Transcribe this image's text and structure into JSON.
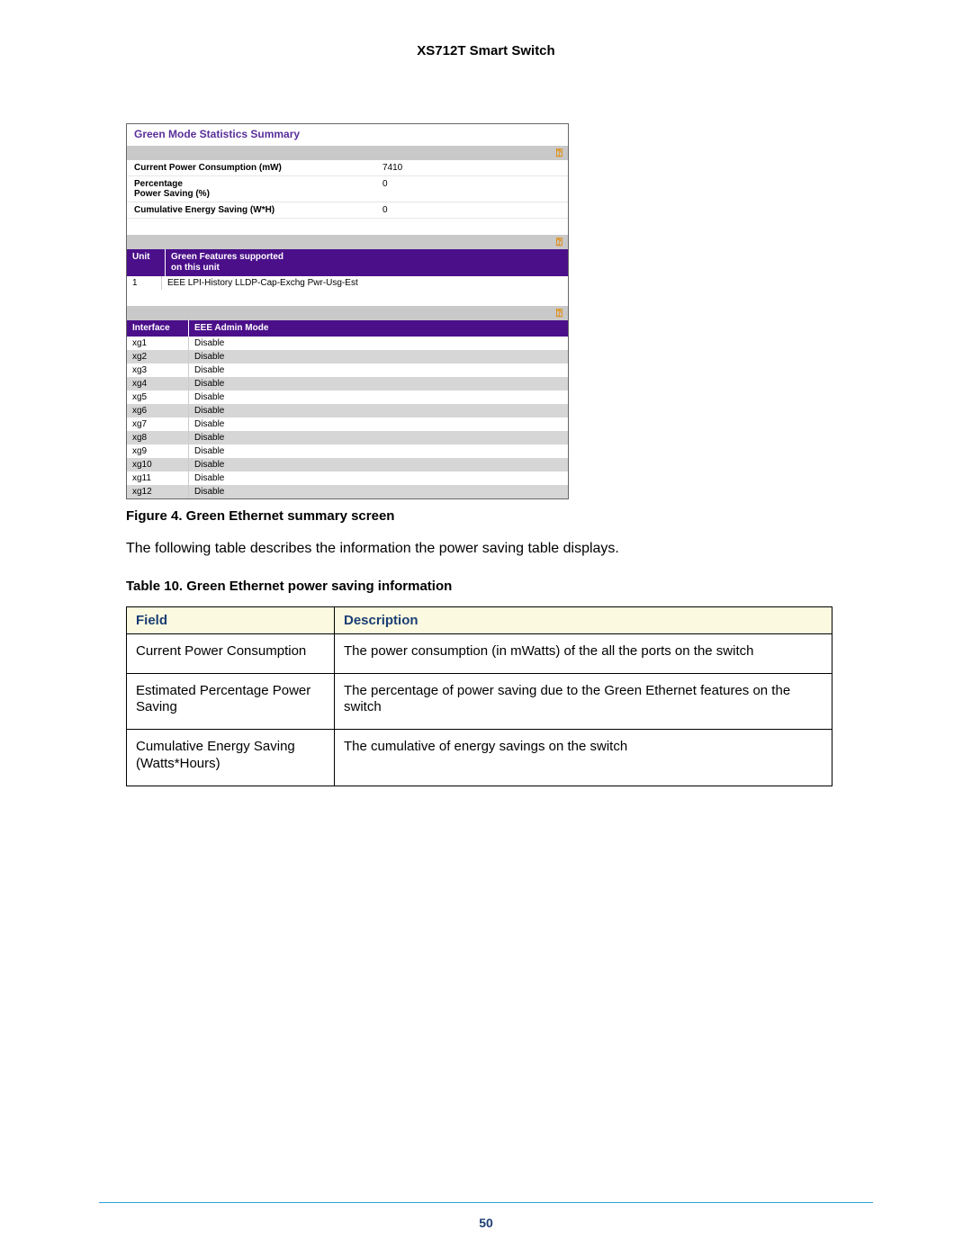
{
  "doc_header": "XS712T Smart Switch",
  "screenshot": {
    "title": "Green Mode Statistics Summary",
    "stats": [
      {
        "label": "Current Power Consumption (mW)",
        "value": "7410"
      },
      {
        "label": "Percentage\nPower Saving (%)",
        "value": "0"
      },
      {
        "label": "Cumulative Energy Saving (W*H)",
        "value": "0"
      }
    ],
    "unit_header": {
      "col1": "Unit",
      "col2": "Green Features supported\non this unit"
    },
    "unit_rows": [
      {
        "unit": "1",
        "features": "EEE LPI-History LLDP-Cap-Exchg Pwr-Usg-Est"
      }
    ],
    "iface_header": {
      "col1": "Interface",
      "col2": "EEE Admin Mode"
    },
    "iface_rows": [
      {
        "iface": "xg1",
        "mode": "Disable"
      },
      {
        "iface": "xg2",
        "mode": "Disable"
      },
      {
        "iface": "xg3",
        "mode": "Disable"
      },
      {
        "iface": "xg4",
        "mode": "Disable"
      },
      {
        "iface": "xg5",
        "mode": "Disable"
      },
      {
        "iface": "xg6",
        "mode": "Disable"
      },
      {
        "iface": "xg7",
        "mode": "Disable"
      },
      {
        "iface": "xg8",
        "mode": "Disable"
      },
      {
        "iface": "xg9",
        "mode": "Disable"
      },
      {
        "iface": "xg10",
        "mode": "Disable"
      },
      {
        "iface": "xg11",
        "mode": "Disable"
      },
      {
        "iface": "xg12",
        "mode": "Disable"
      }
    ]
  },
  "fig_caption": "Figure 4. Green Ethernet summary screen",
  "para_text": "The following table describes the information the power saving table displays.",
  "table_caption": "Table 10.  Green Ethernet power saving information",
  "desc_header": {
    "c1": "Field",
    "c2": "Description"
  },
  "desc_rows": [
    {
      "field": "Current Power Consumption",
      "desc": "The power consumption (in mWatts) of the all the ports on the switch"
    },
    {
      "field": "Estimated Percentage Power Saving",
      "desc": "The percentage of power saving due to the Green Ethernet features on the switch"
    },
    {
      "field": "Cumulative Energy Saving (Watts*Hours)",
      "desc": "The cumulative of energy savings on the switch"
    }
  ],
  "page_number": "50",
  "help_glyph": "⍰"
}
